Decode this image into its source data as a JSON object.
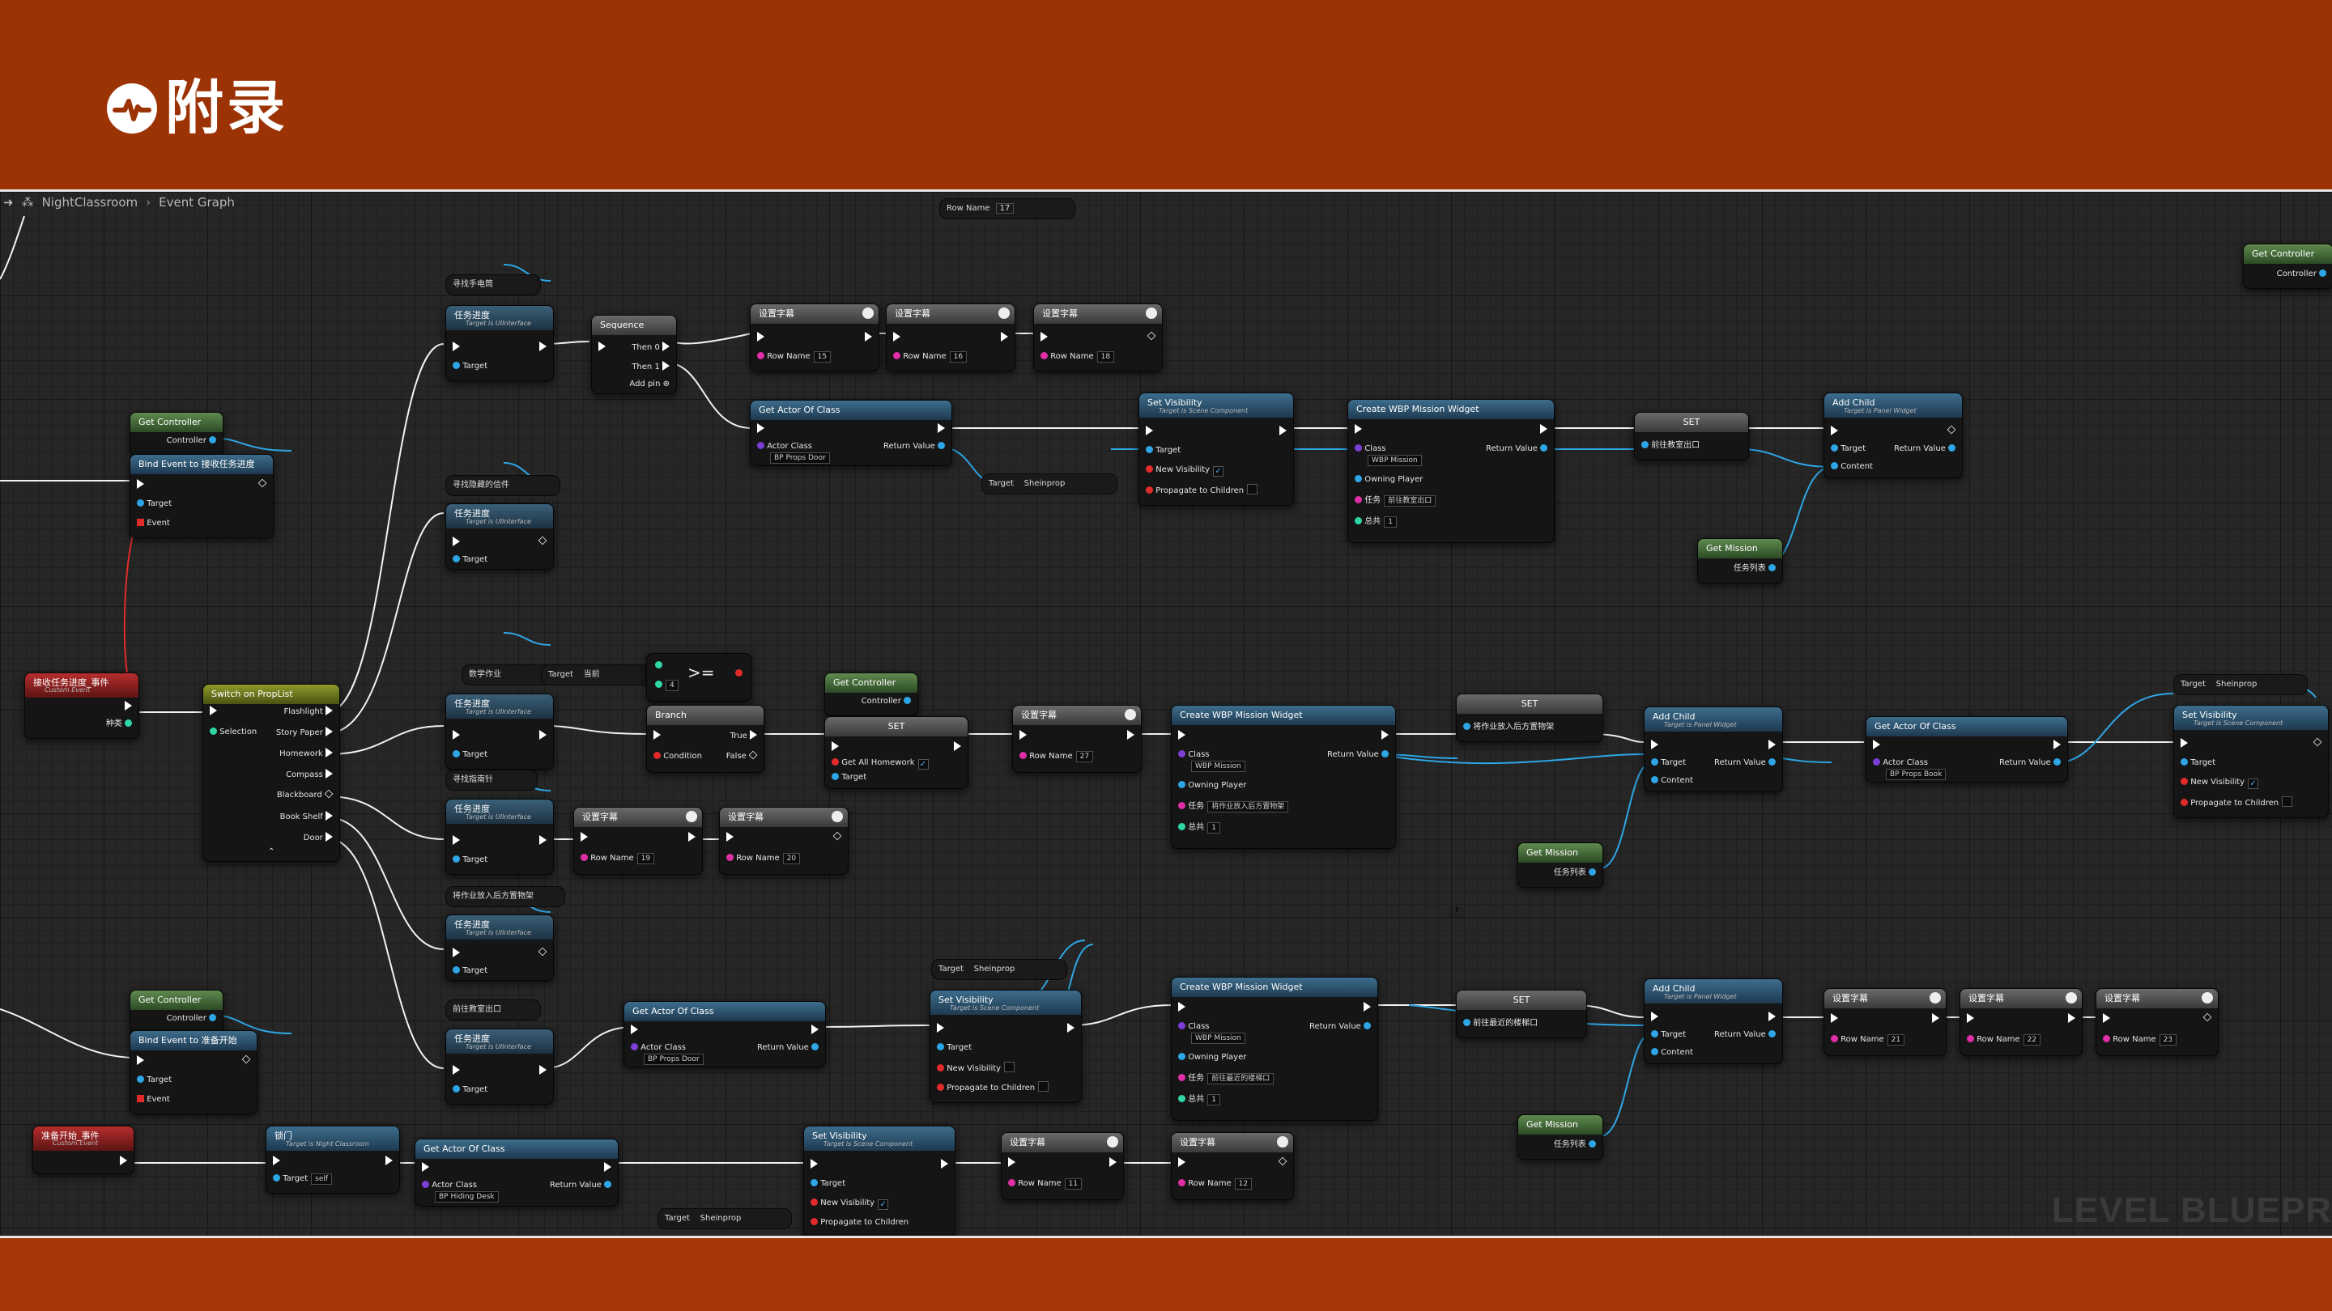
{
  "slide": {
    "title": "附录",
    "logo_icon": "heartbeat-icon"
  },
  "breadcrumb": {
    "items": [
      "NightClassroom",
      "Event Graph"
    ]
  },
  "watermark": "LEVEL BLUEPR",
  "floating_pins": {
    "row_name_top": "Row Name",
    "row_name_top_value": "17"
  },
  "labels": {
    "target": "Target",
    "controller": "Controller",
    "event": "Event",
    "row_name": "Row Name",
    "actor_class": "Actor Class",
    "return_value": "Return Value",
    "shoinprop": "Sheinprop",
    "class": "Class",
    "owning_player": "Owning Player",
    "task": "任务",
    "total": "总共",
    "content": "Content",
    "new_visibility": "New Visibility",
    "propagate": "Propagate to Children",
    "task_list": "任务列表",
    "target_is_scene": "Target is Scene Component",
    "target_is_panel": "Target is Panel Widget",
    "target_is_ui": "Target is UIInterface",
    "custom_event": "Custom Event",
    "get_mission": "Get Mission",
    "get_controller": "Get Controller",
    "get_actor_of_class": "Get Actor Of Class",
    "set_visibility": "Set Visibility",
    "create_wbp": "Create WBP Mission Widget",
    "add_child": "Add Child",
    "set": "SET",
    "wbp_mission": "WBP Mission",
    "bp_props_door": "BP Props Door",
    "bp_props_book": "BP Props Book",
    "bp_hiding_desk": "BP Hiding Desk",
    "task_progress": "任务进度",
    "set_row": "设置字幕"
  },
  "nodes": {
    "find_phone": "寻找手电筒",
    "find_letter": "寻找隐藏的信件",
    "bind_event_1": "Bind Event to 接收任务进度",
    "bind_event_2": "Bind Event to 准备开始",
    "receive_event": "接收任务进度_事件",
    "receive_pin": "种类",
    "switch_title": "Switch on PropList",
    "switch_selection": "Selection",
    "switch_items": [
      "Flashlight",
      "Story Paper",
      "Homework",
      "Compass",
      "Blackboard",
      "Book Shelf",
      "Door"
    ],
    "sequence": "Sequence",
    "then0": "Then 0",
    "then1": "Then 1",
    "add_pin": "Add pin",
    "row_15": "15",
    "row_16": "16",
    "row_18": "18",
    "row_19": "19",
    "row_20": "20",
    "row_27": "27",
    "row_21": "21",
    "row_22": "22",
    "row_23": "23",
    "row_11": "11",
    "row_12": "12",
    "total_1": "1",
    "task_a": "前往教室出口",
    "task_b": "将作业放入后方置物架",
    "task_c": "前往最近的楼梯口",
    "var_exit": "前往教室出口",
    "var_homework": "将作业放入后方置物架",
    "var_stairs": "前往最近的楼梯口",
    "homework_count": "数学作业",
    "current": "当前",
    "compare": ">=",
    "compare_val": "4",
    "branch": "Branch",
    "condition": "Condition",
    "true": "True",
    "false": "False",
    "get_all_homework": "Get All Homework",
    "find_compass": "寻找指南针",
    "put_homework": "将作业放入后方置物架",
    "go_exit": "前往教室出口",
    "ready_event": "准备开始_事件",
    "lock": "锁门",
    "lock_sub": "Target is Night Classroom",
    "self": "self"
  },
  "colors": {
    "slide_bg": "#a63607",
    "exec": "#ffffff",
    "object_pin": "#2ea6e6",
    "event_pin": "#e12b2b"
  }
}
